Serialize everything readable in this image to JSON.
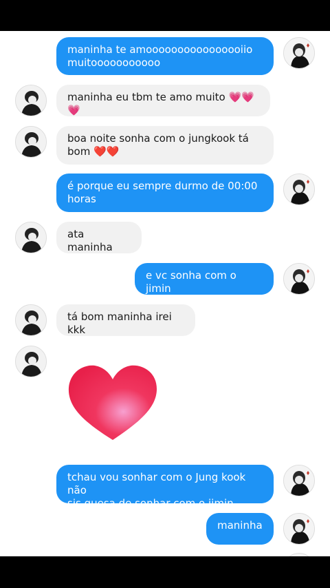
{
  "messages": [
    {
      "side": "sent",
      "text": "maninha te amoooooooooooooooiio\nmuitooooooooooo"
    },
    {
      "side": "received",
      "text": "maninha eu tbm te amo muito 💗💗💗"
    },
    {
      "side": "received",
      "text": "boa noite sonha com o jungkook tá\nbom ❤️❤️"
    },
    {
      "side": "sent",
      "text": "é porque eu sempre durmo de 00:00\nhoras"
    },
    {
      "side": "received",
      "text": "ata maninha"
    },
    {
      "side": "sent",
      "text": "e vc sonha com o jimin"
    },
    {
      "side": "received",
      "text": "tá bom maninha irei kkk"
    },
    {
      "side": "received",
      "sticker": "heart-sticker"
    },
    {
      "side": "sent",
      "text": "tchau vou sonhar com o Jung kook não\nsis quesa de sonhar com o jimin"
    },
    {
      "side": "sent",
      "text": "maninha"
    }
  ],
  "colors": {
    "sent_bubble": "#1e93f5",
    "received_bubble": "#f1f1f1",
    "heart": "#f0365f"
  }
}
